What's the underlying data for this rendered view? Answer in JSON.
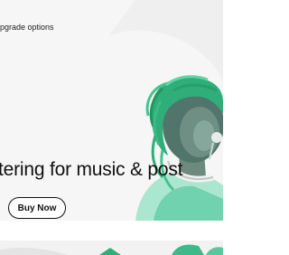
{
  "header": {
    "upgrade_label": "pgrade options"
  },
  "hero": {
    "headline": "tering for music & post",
    "buy_label": "Buy Now",
    "image_subject": "person-with-headphones",
    "accent_color": "#3db98a"
  }
}
